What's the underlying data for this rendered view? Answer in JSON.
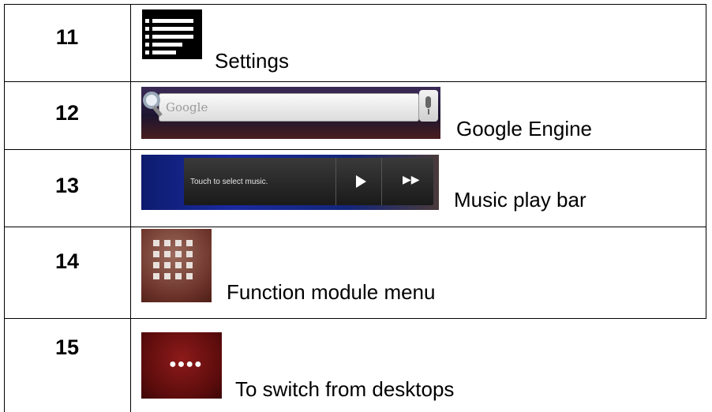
{
  "rows": [
    {
      "number": "11",
      "label": "Settings",
      "icon": "list-menu-icon"
    },
    {
      "number": "12",
      "label": "Google Engine",
      "icon": "google-search-bar",
      "search_placeholder": "Google"
    },
    {
      "number": "13",
      "label": "Music play bar",
      "icon": "music-play-bar",
      "music_text": "Touch to select music."
    },
    {
      "number": "14",
      "label": "Function module menu",
      "icon": "grid-menu-icon"
    },
    {
      "number": "15",
      "label": "To switch from desktops",
      "icon": "desktop-switch-icon"
    }
  ]
}
